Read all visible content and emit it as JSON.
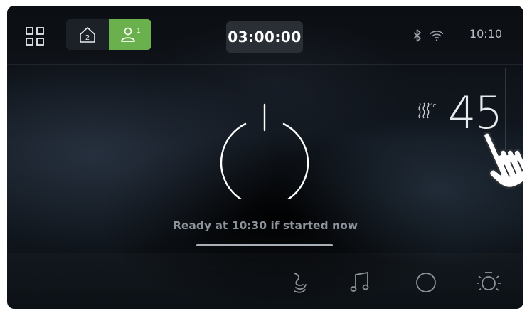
{
  "topbar": {
    "apps_icon": "grid-icon",
    "home_switch": {
      "home_icon": "home-2-icon",
      "home_number": "2",
      "user_icon": "user-1-icon",
      "user_number": "1",
      "active": "user",
      "active_color": "#6ab04c"
    },
    "timer": "03:00:00",
    "status": {
      "bluetooth_icon": "bluetooth-icon",
      "wifi_icon": "wifi-icon",
      "time": "10:10"
    }
  },
  "main": {
    "power_icon": "power-icon",
    "temperature": {
      "icon": "heat-celsius-icon",
      "unit": "°C",
      "value": "45"
    },
    "ready_text": "Ready at 10:30 if started now",
    "progress": 1.0
  },
  "cursor": "hand-pointer-icon",
  "bottombar": {
    "items": [
      {
        "icon": "fan-swirl-icon"
      },
      {
        "icon": "music-note-icon"
      },
      {
        "icon": "circle-icon"
      },
      {
        "icon": "light-icon"
      }
    ]
  }
}
